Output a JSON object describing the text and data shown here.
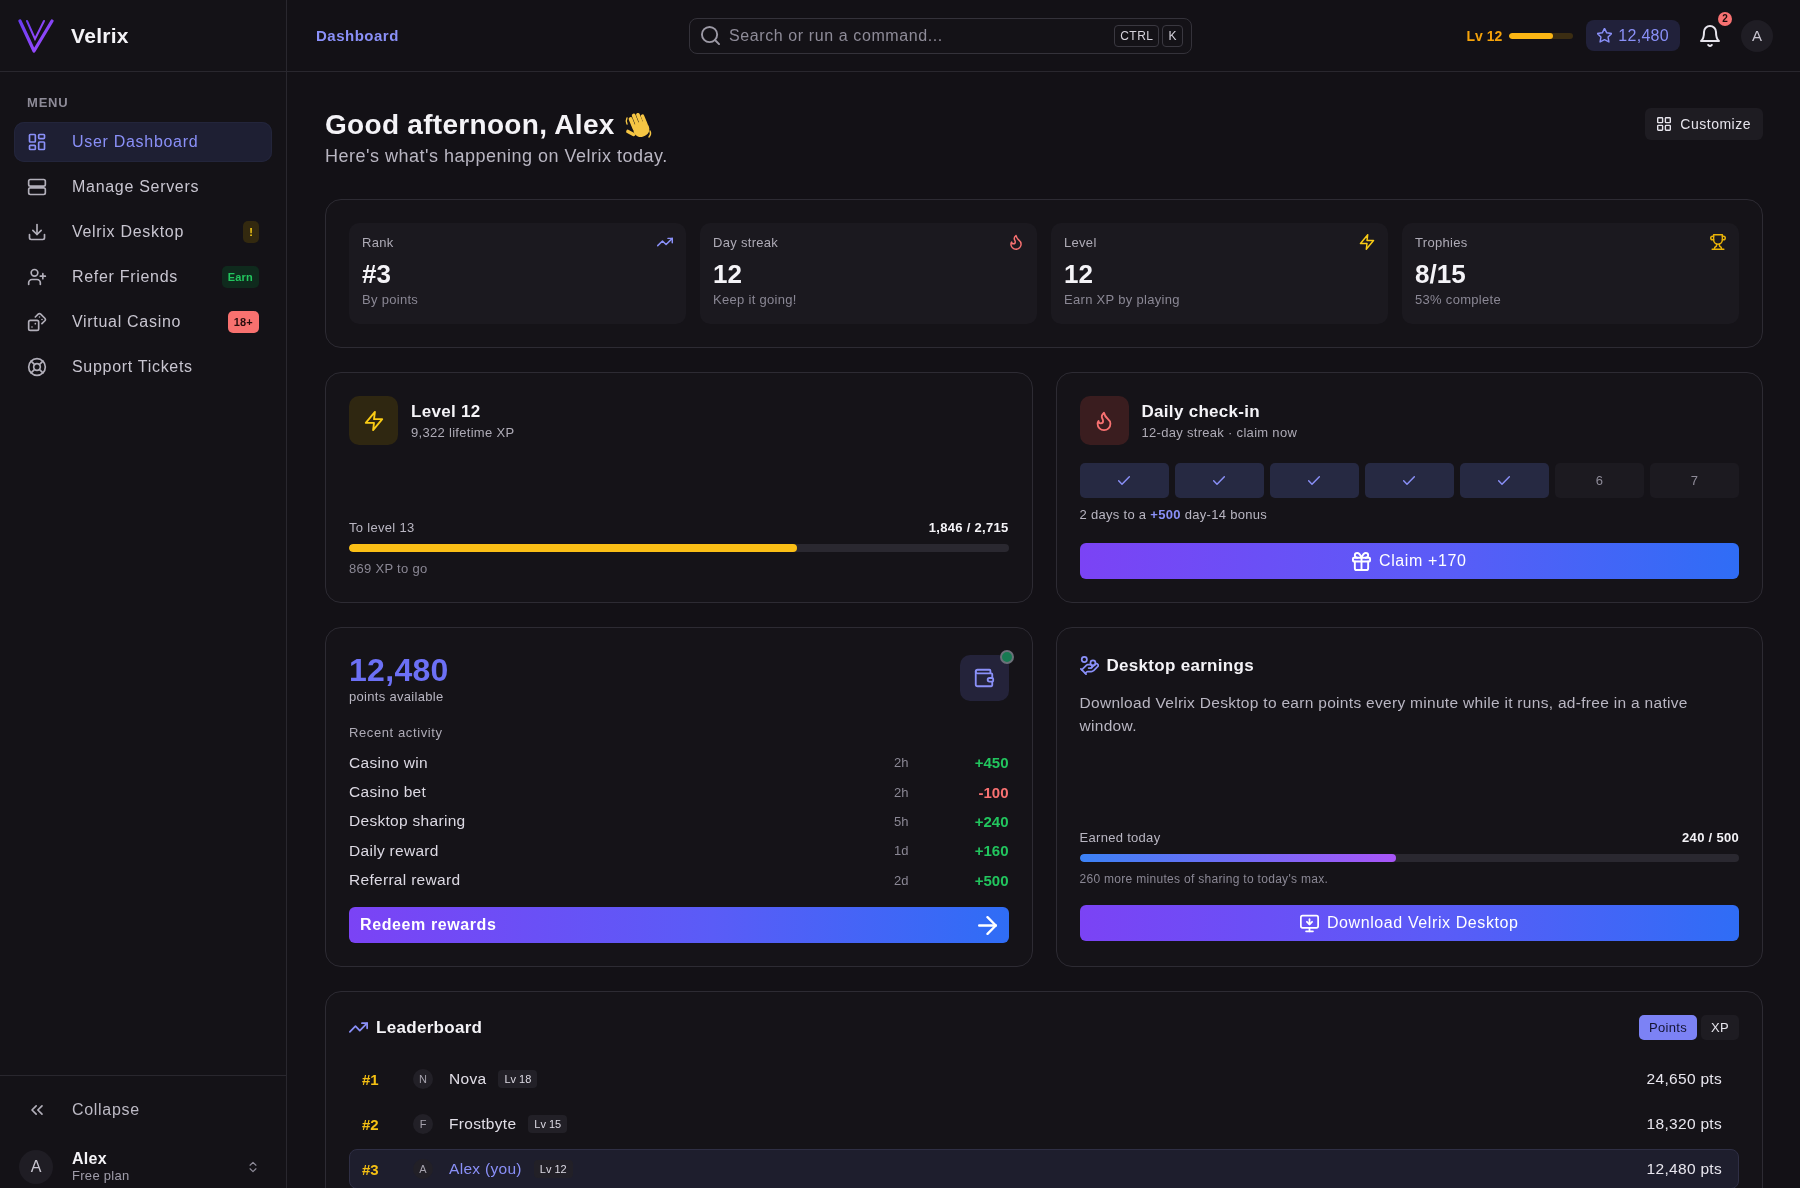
{
  "brand": {
    "name": "Velrix"
  },
  "sidebar": {
    "section_label": "MENU",
    "items": [
      {
        "label": "User Dashboard",
        "selected": true
      },
      {
        "label": "Manage Servers",
        "selected": false
      },
      {
        "label": "Velrix Desktop",
        "selected": false,
        "badge": {
          "text": "!",
          "kind": "warning"
        }
      },
      {
        "label": "Refer Friends",
        "selected": false,
        "badge": {
          "text": "Earn",
          "kind": "success"
        }
      },
      {
        "label": "Virtual Casino",
        "selected": false,
        "badge": {
          "text": "18+",
          "kind": "danger"
        }
      },
      {
        "label": "Support Tickets",
        "selected": false
      }
    ],
    "collapse": "Collapse",
    "user": {
      "avatar": "A",
      "name": "Alex",
      "plan": "Free plan"
    }
  },
  "topbar": {
    "breadcrumb": "Dashboard",
    "search": {
      "placeholder": "Search or run a command...",
      "shortcut": [
        "CTRL",
        "K"
      ]
    },
    "xp": {
      "label": "Lv 12",
      "level": 0.68
    },
    "points": "12,480",
    "notifications": "2",
    "avatar": "A"
  },
  "header": {
    "title": "Good afternoon, Alex",
    "subtitle": "Here's what's happening on Velrix today.",
    "customize": "Customize"
  },
  "stats": [
    {
      "label": "Rank",
      "value": "#3",
      "note": "By points"
    },
    {
      "label": "Day streak",
      "value": "12",
      "note": "Keep it going!"
    },
    {
      "label": "Level",
      "value": "12",
      "note": "Earn XP by playing"
    },
    {
      "label": "Trophies",
      "value": "8/15",
      "note": "53% complete"
    }
  ],
  "level_card": {
    "title": "Level 12",
    "subtitle": "9,322 lifetime XP",
    "progress_label": "To level 13",
    "reading": "1,846 / 2,715",
    "level": 0.68,
    "note": "869 XP to go"
  },
  "checkin": {
    "title": "Daily check-in",
    "subtitle": "12-day streak · claim now",
    "days": [
      {
        "checked": true
      },
      {
        "checked": true
      },
      {
        "checked": true
      },
      {
        "checked": true
      },
      {
        "checked": true
      },
      {
        "label": "6",
        "checked": false
      },
      {
        "label": "7",
        "checked": false
      }
    ],
    "note": "2 days to a **+500** day-14 bonus",
    "button": "Claim +170"
  },
  "points": {
    "value": "12,480",
    "label": "points available",
    "online": true,
    "activity_label": "Recent activity",
    "activity": [
      {
        "label": "Casino win",
        "time": "2h",
        "amount": "+450",
        "kind": "credit"
      },
      {
        "label": "Casino bet",
        "time": "2h",
        "amount": "-100",
        "kind": "debit"
      },
      {
        "label": "Desktop sharing",
        "time": "5h",
        "amount": "+240",
        "kind": "credit"
      },
      {
        "label": "Daily reward",
        "time": "1d",
        "amount": "+160",
        "kind": "credit"
      },
      {
        "label": "Referral reward",
        "time": "2d",
        "amount": "+500",
        "kind": "credit"
      }
    ],
    "button": "Redeem rewards"
  },
  "earnings": {
    "title": "Desktop earnings",
    "description": "Download Velrix Desktop to earn points every minute while it runs, ad-free in a native window.",
    "progress_label": "Earned today",
    "reading": "240 / 500",
    "level": 0.48,
    "note": "260 more minutes of sharing to today's max.",
    "button": "Download Velrix Desktop"
  },
  "leaderboard": {
    "title": "Leaderboard",
    "tabs": [
      {
        "label": "Points",
        "selected": true
      },
      {
        "label": "XP",
        "selected": false
      }
    ],
    "rows": [
      {
        "rank": "#1",
        "avatar": "N",
        "name": "Nova",
        "level_badge": "Lv 18",
        "points": "24,650 pts",
        "current": false
      },
      {
        "rank": "#2",
        "avatar": "F",
        "name": "Frostbyte",
        "level_badge": "Lv 15",
        "points": "18,320 pts",
        "current": false
      },
      {
        "rank": "#3",
        "avatar": "A",
        "name": "Alex (you)",
        "level_badge": "Lv 12",
        "points": "12,480 pts",
        "current": true
      }
    ]
  }
}
